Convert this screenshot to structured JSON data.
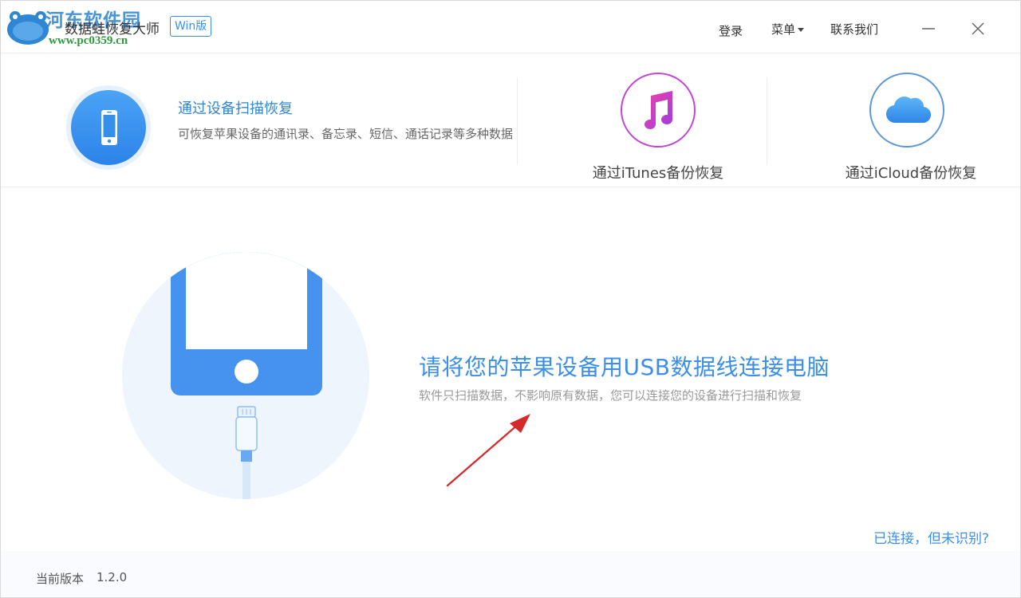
{
  "window": {
    "app_title": "数据蛙恢复大师",
    "badge": "Win版",
    "watermark_title": "河东软件园",
    "watermark_url": "www.pc0359.cn"
  },
  "toolbar": {
    "login": "登录",
    "menu": "菜单",
    "contact": "联系我们"
  },
  "modes": {
    "scan": {
      "title": "通过设备扫描恢复",
      "description": "可恢复苹果设备的通讯录、备忘录、短信、通话记录等多种数据"
    },
    "itunes": {
      "label": "通过iTunes备份恢复"
    },
    "icloud": {
      "label": "通过iCloud备份恢复"
    }
  },
  "main": {
    "prompt_title": "请将您的苹果设备用USB数据线连接电脑",
    "prompt_subtitle": "软件只扫描数据，不影响原有数据，您可以连接您的设备进行扫描和恢复",
    "help_link": "已连接，但未识别?"
  },
  "footer": {
    "version_label": "当前版本",
    "version": "1.2.0"
  },
  "colors": {
    "accent": "#3b8fe8",
    "itunes_ring": "#c245d6",
    "icloud_ring": "#5e97d9",
    "arrow": "#d42a2a"
  },
  "icons": {
    "logo": "data-frog-logo-icon",
    "minimize": "minimize-icon",
    "close": "close-icon",
    "scan": "iphone-icon",
    "itunes": "music-note-icon",
    "icloud": "cloud-icon"
  }
}
